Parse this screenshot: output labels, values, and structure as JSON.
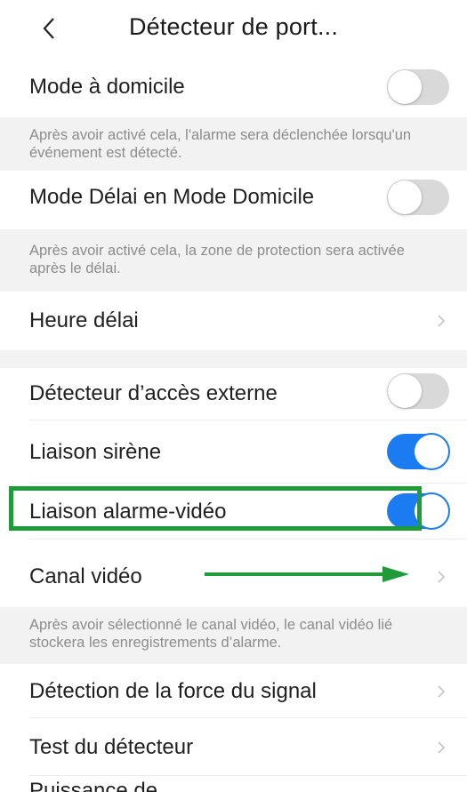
{
  "header": {
    "title": "Détecteur de port...",
    "back_icon": "chevron-left-icon"
  },
  "rows": {
    "home_mode": {
      "label": "Mode à domicile",
      "toggle": "off"
    },
    "home_mode_note": "Après avoir activé cela, l'alarme sera déclenchée lorsqu'un événement est détecté.",
    "delay_mode": {
      "label": "Mode Délai en Mode Domicile",
      "toggle": "off"
    },
    "delay_mode_note": "Après avoir activé cela, la zone de protection sera activée après le délai.",
    "delay_time": {
      "label": "Heure délai"
    },
    "external_detector": {
      "label": "Détecteur d’accès externe",
      "toggle": "off"
    },
    "siren_link": {
      "label": "Liaison sirène",
      "toggle": "on"
    },
    "alarm_video_link": {
      "label": "Liaison alarme-vidéo",
      "toggle": "on"
    },
    "video_channel": {
      "label": "Canal vidéo"
    },
    "video_channel_note": "Après avoir sélectionné le canal vidéo, le canal vidéo lié stockera les enregistrements d’alarme.",
    "signal_strength": {
      "label": "Détection de la force du signal"
    },
    "detector_test": {
      "label": "Test du détecteur"
    },
    "partial_next": {
      "label": "Puissance de"
    }
  },
  "colors": {
    "accent": "#1a7cf0",
    "annotation": "#1f9b3a",
    "note_bg": "#f2f2f2"
  }
}
